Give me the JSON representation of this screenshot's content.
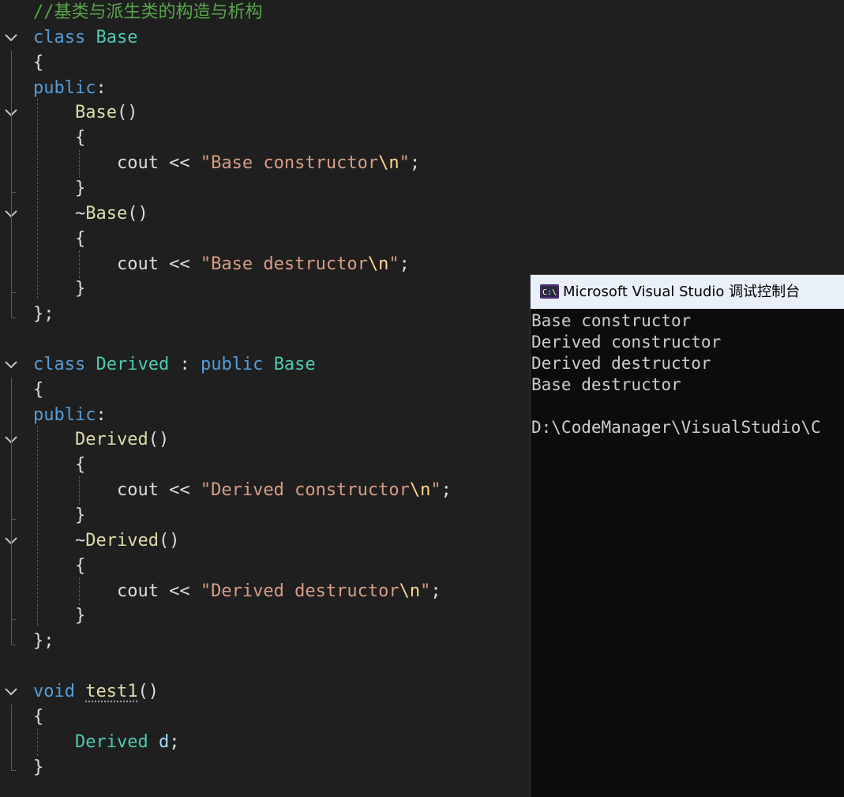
{
  "editor": {
    "lines": [
      {
        "tokens": [
          {
            "t": "//基类与派生类的构造与析构",
            "c": "comment"
          }
        ]
      },
      {
        "fold": true,
        "tokens": [
          {
            "t": "class",
            "c": "kw"
          },
          {
            "t": " "
          },
          {
            "t": "Base",
            "c": "type"
          }
        ]
      },
      {
        "tokens": [
          {
            "t": "{"
          }
        ]
      },
      {
        "tokens": [
          {
            "t": "public",
            "c": "kw"
          },
          {
            "t": ":"
          }
        ]
      },
      {
        "fold": true,
        "tokens": [
          {
            "t": "    "
          },
          {
            "t": "Base",
            "c": "fn"
          },
          {
            "t": "()"
          }
        ]
      },
      {
        "tokens": [
          {
            "t": "    {"
          }
        ]
      },
      {
        "tokens": [
          {
            "t": "        cout << "
          },
          {
            "t": "\"Base constructor",
            "c": "str"
          },
          {
            "t": "\\n",
            "c": "esc"
          },
          {
            "t": "\"",
            "c": "str"
          },
          {
            "t": ";"
          }
        ]
      },
      {
        "tokens": [
          {
            "t": "    }"
          }
        ]
      },
      {
        "fold": true,
        "tokens": [
          {
            "t": "    ~"
          },
          {
            "t": "Base",
            "c": "fn"
          },
          {
            "t": "()"
          }
        ]
      },
      {
        "tokens": [
          {
            "t": "    {"
          }
        ]
      },
      {
        "tokens": [
          {
            "t": "        cout << "
          },
          {
            "t": "\"Base destructor",
            "c": "str"
          },
          {
            "t": "\\n",
            "c": "esc"
          },
          {
            "t": "\"",
            "c": "str"
          },
          {
            "t": ";"
          }
        ]
      },
      {
        "tokens": [
          {
            "t": "    }"
          }
        ]
      },
      {
        "tokens": [
          {
            "t": "};"
          }
        ]
      },
      {
        "tokens": []
      },
      {
        "fold": true,
        "tokens": [
          {
            "t": "class",
            "c": "kw"
          },
          {
            "t": " "
          },
          {
            "t": "Derived",
            "c": "type"
          },
          {
            "t": " : "
          },
          {
            "t": "public",
            "c": "kw"
          },
          {
            "t": " "
          },
          {
            "t": "Base",
            "c": "type"
          }
        ]
      },
      {
        "tokens": [
          {
            "t": "{"
          }
        ]
      },
      {
        "tokens": [
          {
            "t": "public",
            "c": "kw"
          },
          {
            "t": ":"
          }
        ]
      },
      {
        "fold": true,
        "tokens": [
          {
            "t": "    "
          },
          {
            "t": "Derived",
            "c": "fn"
          },
          {
            "t": "()"
          }
        ]
      },
      {
        "tokens": [
          {
            "t": "    {"
          }
        ]
      },
      {
        "tokens": [
          {
            "t": "        cout << "
          },
          {
            "t": "\"Derived constructor",
            "c": "str"
          },
          {
            "t": "\\n",
            "c": "esc"
          },
          {
            "t": "\"",
            "c": "str"
          },
          {
            "t": ";"
          }
        ]
      },
      {
        "tokens": [
          {
            "t": "    }"
          }
        ]
      },
      {
        "fold": true,
        "tokens": [
          {
            "t": "    ~"
          },
          {
            "t": "Derived",
            "c": "fn"
          },
          {
            "t": "()"
          }
        ]
      },
      {
        "tokens": [
          {
            "t": "    {"
          }
        ]
      },
      {
        "tokens": [
          {
            "t": "        cout << "
          },
          {
            "t": "\"Derived destructor",
            "c": "str"
          },
          {
            "t": "\\n",
            "c": "esc"
          },
          {
            "t": "\"",
            "c": "str"
          },
          {
            "t": ";"
          }
        ]
      },
      {
        "tokens": [
          {
            "t": "    }"
          }
        ]
      },
      {
        "tokens": [
          {
            "t": "};"
          }
        ]
      },
      {
        "tokens": []
      },
      {
        "fold": true,
        "tokens": [
          {
            "t": "void",
            "c": "kw"
          },
          {
            "t": " "
          },
          {
            "t": "test1",
            "c": "fn",
            "squiggle": true
          },
          {
            "t": "()"
          }
        ]
      },
      {
        "tokens": [
          {
            "t": "{"
          }
        ]
      },
      {
        "tokens": [
          {
            "t": "    "
          },
          {
            "t": "Derived",
            "c": "type"
          },
          {
            "t": " "
          },
          {
            "t": "d",
            "c": "var"
          },
          {
            "t": ";"
          }
        ]
      },
      {
        "tokens": [
          {
            "t": "}"
          }
        ]
      }
    ]
  },
  "console": {
    "title": "Microsoft Visual Studio 调试控制台",
    "icon": "console-window-icon",
    "output": [
      "Base constructor",
      "Derived constructor",
      "Derived destructor",
      "Base destructor",
      "",
      "D:\\CodeManager\\VisualStudio\\C"
    ]
  },
  "colors": {
    "editor_bg": "#1f1f1f",
    "comment": "#57a64a",
    "keyword": "#569cd6",
    "type": "#4ec9b0",
    "function": "#dcdcaa",
    "string": "#d69d85",
    "escape": "#ffd68f",
    "console_bg": "#0c0c0c",
    "console_text": "#cccccc",
    "console_title_bg": "#eaf0f9"
  }
}
